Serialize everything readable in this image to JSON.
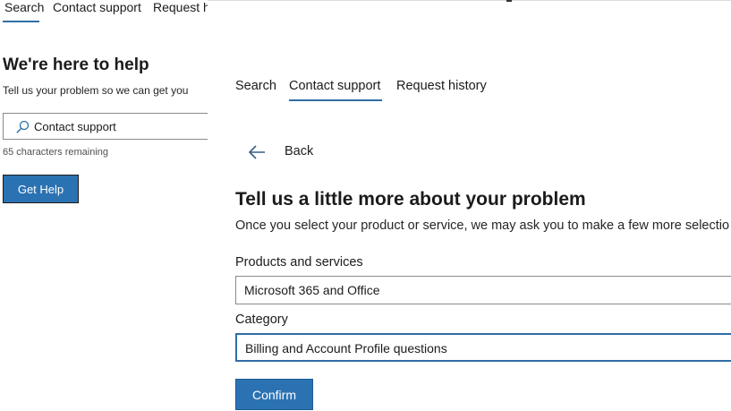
{
  "background_panel": {
    "tabs": [
      "Search",
      "Contact support",
      "Request history"
    ],
    "title": "We're here to help",
    "subtitle": "Tell us your problem so we can get you",
    "search_value": "Contact support",
    "char_counter": "65 characters remaining",
    "get_help_label": "Get Help"
  },
  "foreground_panel": {
    "tabs": {
      "search": "Search",
      "contact_support": "Contact support",
      "request_history": "Request history"
    },
    "active_tab": "Contact support",
    "back_label": "Back",
    "heading": "Tell us a little more about your problem",
    "intro": "Once you select your product or service, we may ask you to make a few more selectio",
    "products_label": "Products and services",
    "products_value": "Microsoft 365 and Office",
    "category_label": "Category",
    "category_value": "Billing and Account Profile questions",
    "confirm_label": "Confirm"
  },
  "colors": {
    "accent": "#2b72b3",
    "underline": "#2f6ea5",
    "text": "#1b1b1b",
    "border": "#8a8a8a"
  },
  "icons": [
    "search-icon",
    "back-arrow-icon"
  ]
}
